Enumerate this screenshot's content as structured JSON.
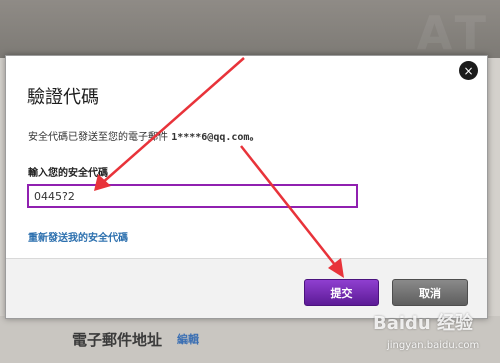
{
  "background": {
    "email_section_label": "電子郵件地址",
    "edit_link": "編輯"
  },
  "dialog": {
    "title": "驗證代碼",
    "description_prefix": "安全代碼已發送至您的電子郵件",
    "email": "1****6@qq.com。",
    "input_label": "輸入您的安全代碼",
    "code_value": "0445?2",
    "resend_link": "重新發送我的安全代碼",
    "submit_label": "提交",
    "cancel_label": "取消",
    "close_symbol": "×"
  },
  "colors": {
    "accent": "#7a2bbf",
    "annotation_arrow": "#e8333a"
  },
  "watermark": {
    "brand": "Baidu 经验",
    "url": "jingyan.baidu.com"
  }
}
